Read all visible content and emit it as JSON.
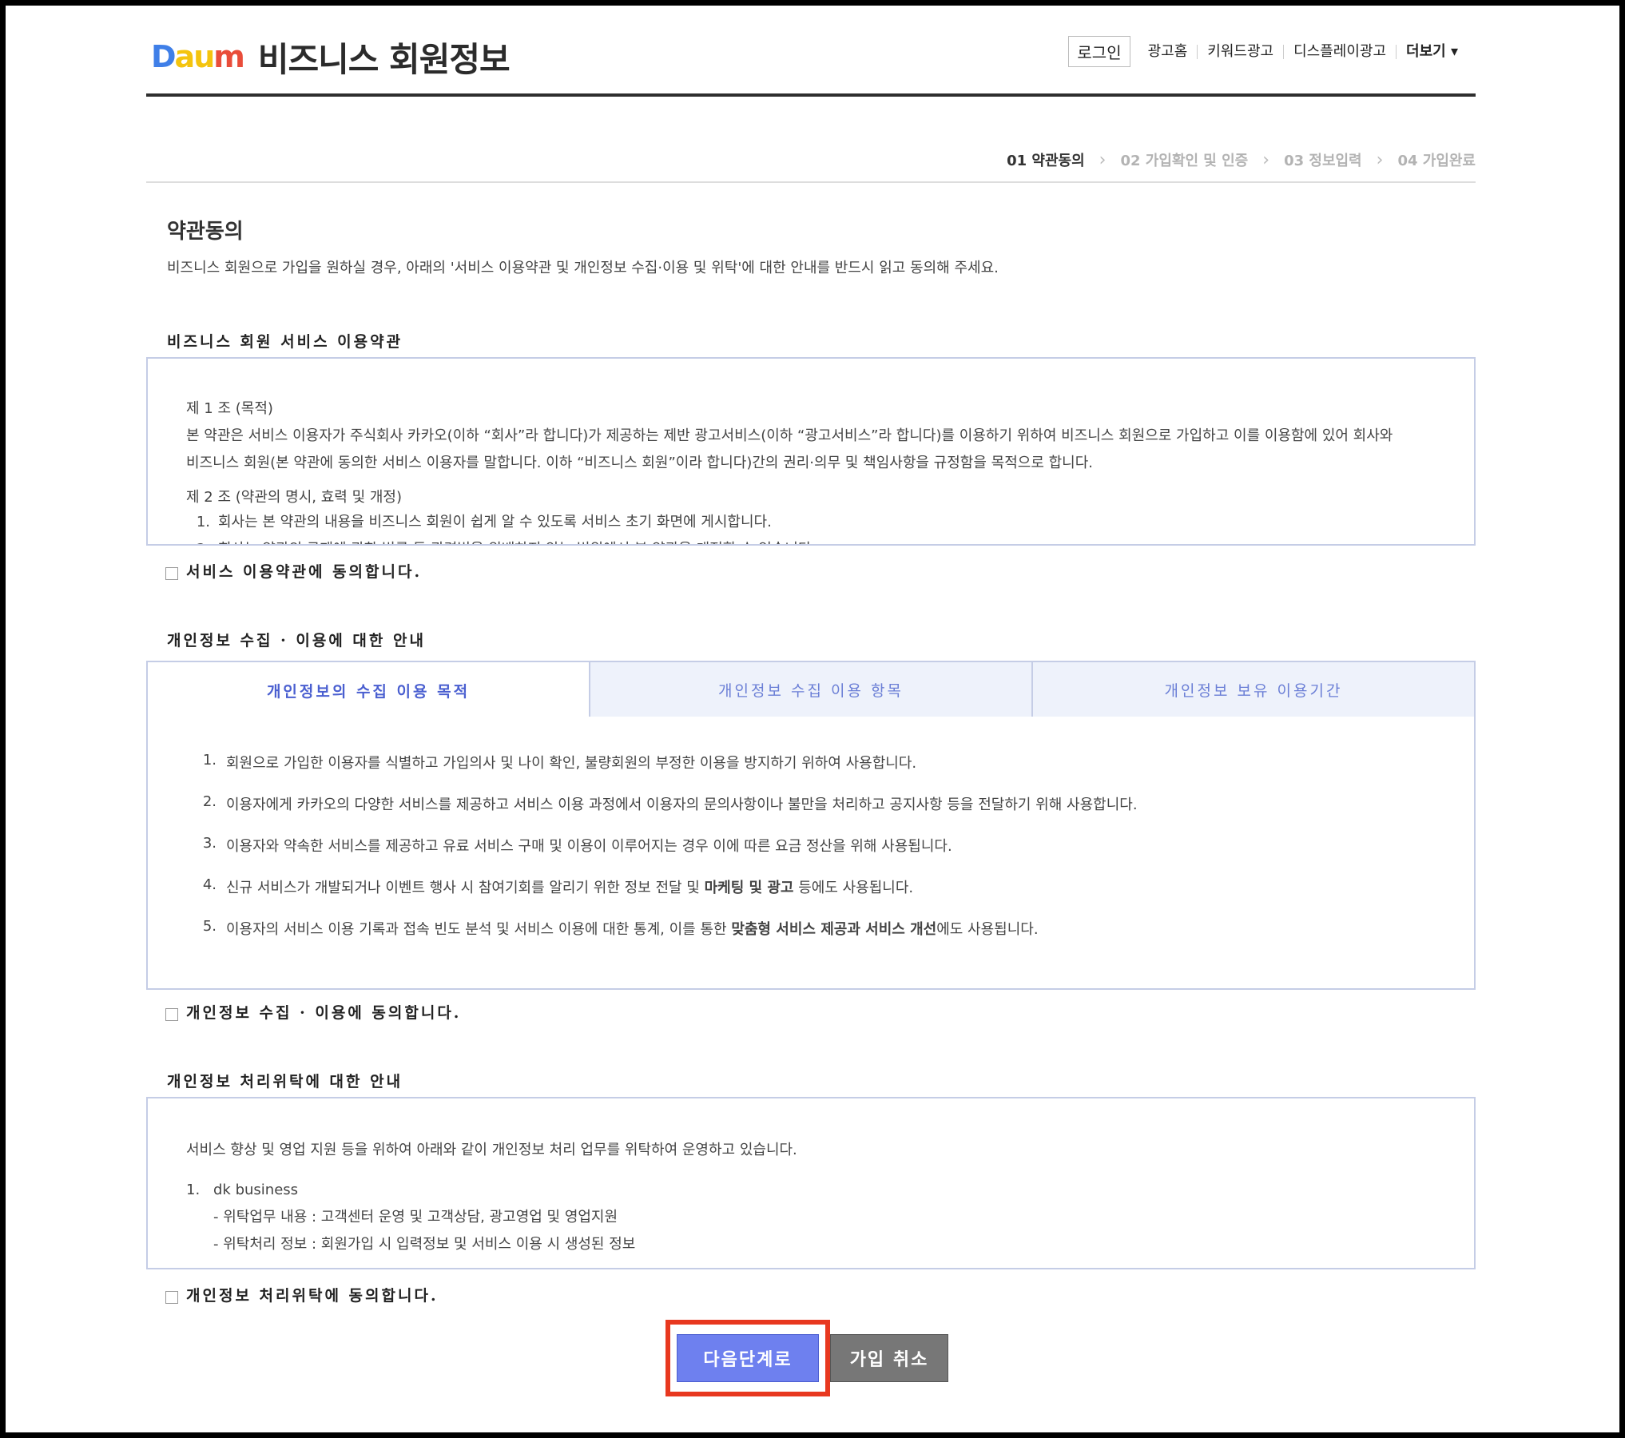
{
  "header": {
    "logo_text": [
      "D",
      "a",
      "u",
      "m"
    ],
    "title": "비즈니스 회원정보",
    "nav": {
      "login": "로그인",
      "links": [
        "광고홈",
        "키워드광고",
        "디스플레이광고"
      ],
      "more": "더보기 ▾"
    }
  },
  "steps": [
    {
      "label": "01 약관동의",
      "active": true
    },
    {
      "label": "02 가입확인 및 인증",
      "active": false
    },
    {
      "label": "03 정보입력",
      "active": false
    },
    {
      "label": "04 가입완료",
      "active": false
    }
  ],
  "intro": {
    "title": "약관동의",
    "description": "비즈니스 회원으로 가입을 원하실 경우, 아래의 '서비스 이용약관 및 개인정보 수집·이용 및 위탁'에 대한 안내를 반드시 읽고 동의해 주세요."
  },
  "terms": {
    "heading": "비즈니스 회원 서비스 이용약관",
    "article1_title": "제 1 조 (목적)",
    "article1_line1": "본 약관은 서비스 이용자가 주식회사 카카오(이하 “회사”라 합니다)가 제공하는 제반 광고서비스(이하 “광고서비스”라 합니다)를 이용하기 위하여 비즈니스 회원으로 가입하고 이를 이용함에 있어 회사와",
    "article1_line2": "비즈니스 회원(본 약관에 동의한 서비스 이용자를 말합니다. 이하 “비즈니스 회원”이라 합니다)간의 권리·의무 및 책임사항을 규정함을 목적으로 합니다.",
    "article2_title": "제 2 조 (약관의 명시, 효력 및 개정)",
    "article2_item1": "회사는 본 약관의 내용을 비즈니스 회원이 쉽게 알 수 있도록 서비스 초기 화면에 게시합니다.",
    "article2_item2": "회사는 약관의 규제에 관한 법률 등 관련법을 위배하지 않는 범위에서 본 약관을 개정할 수 있습니다.",
    "agree": "서비스 이용약관에 동의합니다."
  },
  "privacy": {
    "heading": "개인정보 수집 · 이용에 대한 안내",
    "tabs": [
      "개인정보의 수집 이용 목적",
      "개인정보 수집 이용 항목",
      "개인정보 보유 이용기간"
    ],
    "items": [
      {
        "num": "1.",
        "text": "회원으로 가입한 이용자를 식별하고 가입의사 및 나이 확인, 불량회원의 부정한 이용을 방지하기 위하여 사용합니다."
      },
      {
        "num": "2.",
        "text": "이용자에게 카카오의 다양한 서비스를 제공하고 서비스 이용 과정에서 이용자의 문의사항이나 불만을 처리하고 공지사항 등을 전달하기 위해 사용합니다."
      },
      {
        "num": "3.",
        "text": "이용자와 약속한 서비스를 제공하고 유료 서비스 구매 및 이용이 이루어지는 경우 이에 따른 요금 정산을 위해 사용됩니다."
      },
      {
        "num": "4.",
        "pre": "신규 서비스가 개발되거나 이벤트 행사 시 참여기회를 알리기 위한 정보 전달 및 ",
        "bold": "마케팅 및 광고",
        "post": " 등에도 사용됩니다."
      },
      {
        "num": "5.",
        "pre": "이용자의 서비스 이용 기록과 접속 빈도 분석 및 서비스 이용에 대한 통계, 이를 통한 ",
        "bold": "맞춤형 서비스 제공과 서비스 개선",
        "post": "에도 사용됩니다."
      }
    ],
    "agree": "개인정보 수집 · 이용에 동의합니다."
  },
  "entrust": {
    "heading": "개인정보 처리위탁에 대한 안내",
    "intro": "서비스 향상 및 영업 지원 등을 위하여 아래와 같이 개인정보 처리 업무를 위탁하여 운영하고 있습니다.",
    "item_num": "1.",
    "item_name": "dk business",
    "detail1": "- 위탁업무 내용 : 고객센터 운영 및 고객상담, 광고영업 및 영업지원",
    "detail2": "- 위탁처리 정보 : 회원가입 시 입력정보 및 서비스 이용 시 생성된 정보",
    "agree": "개인정보 처리위탁에 동의합니다."
  },
  "buttons": {
    "next": "다음단계로",
    "cancel": "가입 취소"
  },
  "colors": {
    "accent_blue": "#6e80ef",
    "highlight_red": "#e8381f",
    "tab_border": "#c5cde6"
  }
}
